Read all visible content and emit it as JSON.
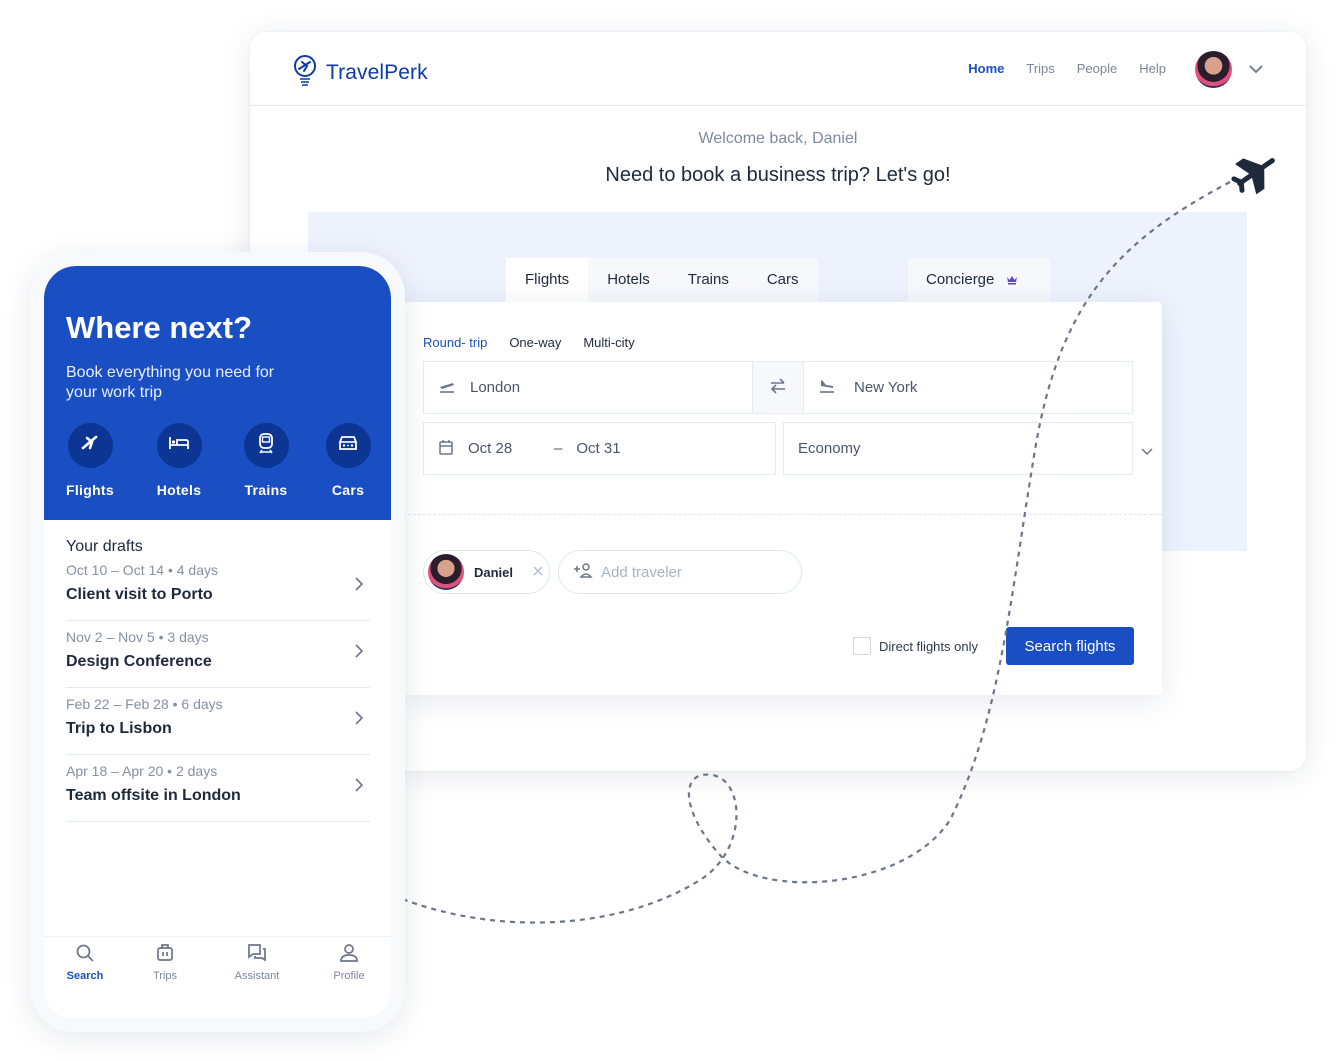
{
  "desktop": {
    "brand": "TravelPerk",
    "nav": [
      {
        "label": "Home",
        "active": true
      },
      {
        "label": "Trips",
        "active": false
      },
      {
        "label": "People",
        "active": false
      },
      {
        "label": "Help",
        "active": false
      }
    ],
    "welcome": "Welcome back, Daniel",
    "headline": "Need to book a business trip? Let's go!",
    "tabs": [
      "Flights",
      "Hotels",
      "Trains",
      "Cars"
    ],
    "active_tab": "Flights",
    "concierge_label": "Concierge",
    "trip_types": [
      "Round- trip",
      "One-way",
      "Multi-city"
    ],
    "active_trip_type": "Round- trip",
    "from": "London",
    "to": "New York",
    "depart_date": "Oct 28",
    "date_separator": "–",
    "return_date": "Oct 31",
    "cabin_class": "Economy",
    "traveler": "Daniel",
    "add_traveler_placeholder": "Add traveler",
    "direct_flights_label": "Direct flights only",
    "direct_flights_checked": false,
    "search_button": "Search flights"
  },
  "phone": {
    "title": "Where next?",
    "subtitle": "Book everything you need for your work trip",
    "categories": [
      {
        "label": "Flights",
        "icon": "plane-icon"
      },
      {
        "label": "Hotels",
        "icon": "bed-icon"
      },
      {
        "label": "Trains",
        "icon": "train-icon"
      },
      {
        "label": "Cars",
        "icon": "car-icon"
      }
    ],
    "drafts_title": "Your drafts",
    "drafts": [
      {
        "dates": "Oct 10 – Oct 14 • 4 days",
        "name": "Client visit to Porto"
      },
      {
        "dates": "Nov 2 – Nov 5 • 3 days",
        "name": "Design Conference"
      },
      {
        "dates": "Feb 22 – Feb 28 • 6 days",
        "name": "Trip to Lisbon"
      },
      {
        "dates": "Apr 18 – Apr 20 • 2 days",
        "name": "Team offsite in London"
      }
    ],
    "tabbar": [
      {
        "label": "Search",
        "icon": "search-icon",
        "active": true
      },
      {
        "label": "Trips",
        "icon": "suitcase-icon",
        "active": false
      },
      {
        "label": "Assistant",
        "icon": "chat-icon",
        "active": false
      },
      {
        "label": "Profile",
        "icon": "profile-icon",
        "active": false
      }
    ]
  },
  "colors": {
    "brand_blue": "#1a4fc4",
    "dark_text": "#1e2a3b",
    "muted_text": "#7c8797",
    "hero_bg": "#edf2fd",
    "concierge_crown": "#5b48c9"
  }
}
